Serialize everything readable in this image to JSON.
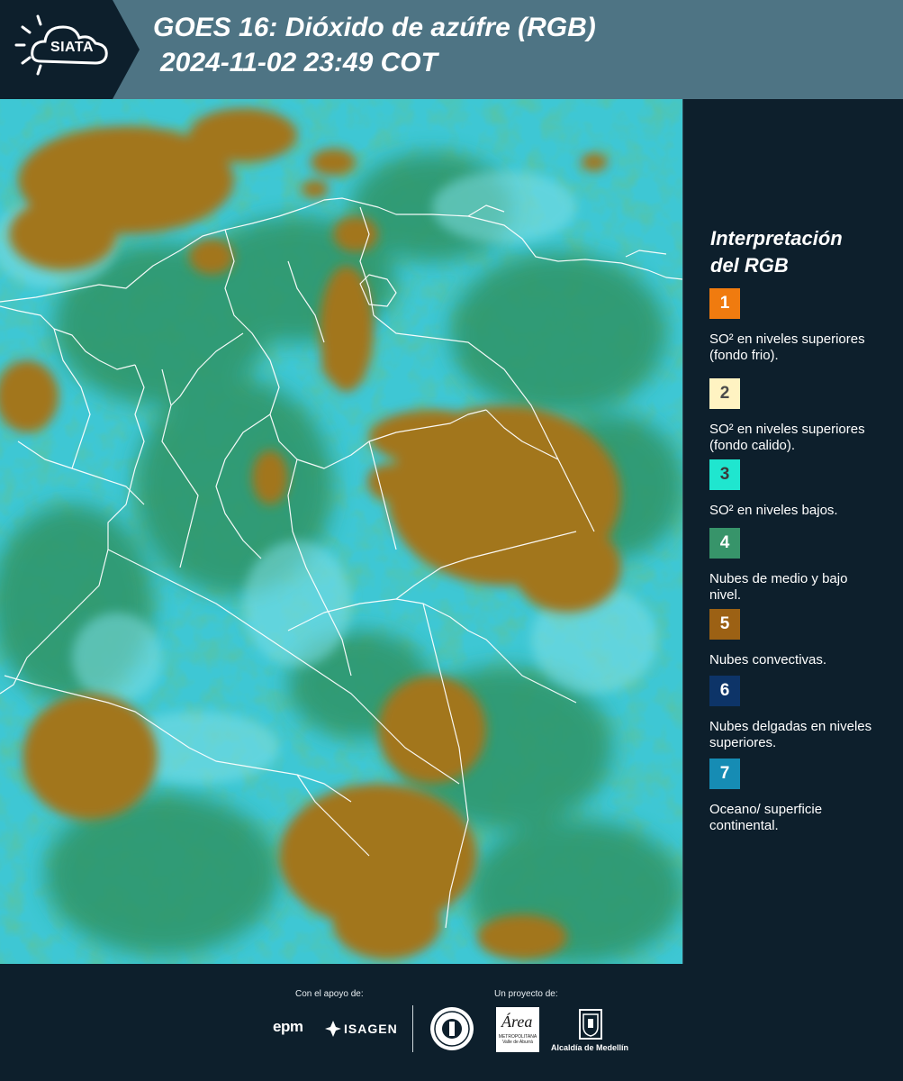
{
  "header": {
    "logo_text": "SIATA",
    "title_line1": "GOES 16: Dióxido de azúfre (RGB)",
    "title_line2": " 2024-11-02 23:49 COT"
  },
  "legend": {
    "title_line1": "Interpretación",
    "title_line2": "del RGB",
    "items": [
      {
        "number": "1",
        "color": "#f07b0f",
        "text_color": "#ffffff",
        "label": "SO² en niveles superiores (fondo frio)."
      },
      {
        "number": "2",
        "color": "#fff3c2",
        "text_color": "#4a4a4a",
        "label": "SO² en niveles superiores (fondo calido)."
      },
      {
        "number": "3",
        "color": "#1fe6cf",
        "text_color": "#3a3a3a",
        "label": "SO² en niveles bajos."
      },
      {
        "number": "4",
        "color": "#37946a",
        "text_color": "#ffffff",
        "label": "Nubes de medio y bajo nivel."
      },
      {
        "number": "5",
        "color": "#9c6114",
        "text_color": "#ffffff",
        "label": "Nubes convectivas."
      },
      {
        "number": "6",
        "color": "#0d3468",
        "text_color": "#ffffff",
        "label": "Nubes delgadas en niveles superiores."
      },
      {
        "number": "7",
        "color": "#168cb4",
        "text_color": "#ffffff",
        "label": "Oceano/ superficie continental."
      }
    ]
  },
  "footer": {
    "support_caption": "Con el apoyo de:",
    "project_caption": "Un proyecto de:",
    "sponsor_1": "epm",
    "sponsor_2": "ISAGEN",
    "area_word": "Área",
    "area_sub": "METROPOLITANA Valle de Aburrá",
    "alcaldia": "Alcaldía de Medellín"
  },
  "colors": {
    "header_bg": "#4e7484",
    "panel_bg": "#0d1f2c",
    "ocean_cyan": "#3ec7d4",
    "land_green": "#2f9466",
    "convective_brown": "#a2761f",
    "border_white": "#ffffff"
  }
}
